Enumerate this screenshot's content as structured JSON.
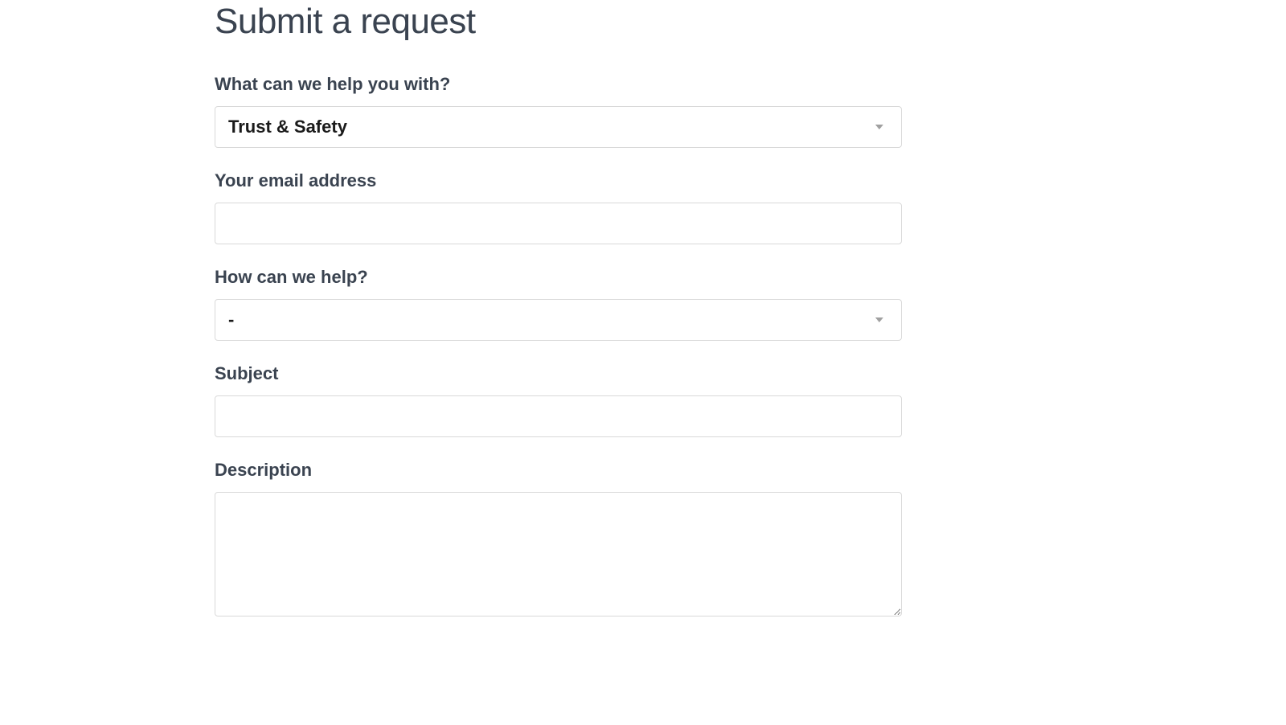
{
  "page": {
    "title": "Submit a request"
  },
  "form": {
    "help_with": {
      "label": "What can we help you with?",
      "value": "Trust & Safety"
    },
    "email": {
      "label": "Your email address",
      "value": ""
    },
    "how_help": {
      "label": "How can we help?",
      "value": "-"
    },
    "subject": {
      "label": "Subject",
      "value": ""
    },
    "description": {
      "label": "Description",
      "value": ""
    }
  }
}
